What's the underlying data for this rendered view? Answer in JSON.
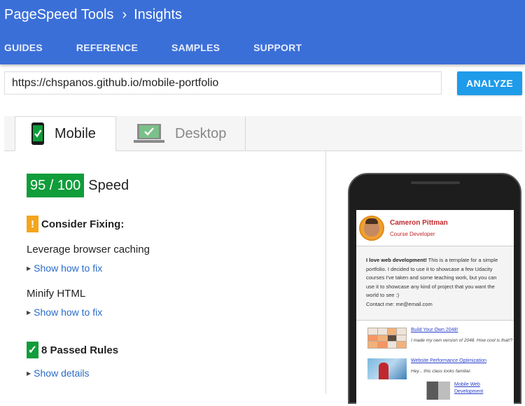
{
  "header": {
    "product": "PageSpeed Tools",
    "chevron": "›",
    "section": "Insights",
    "nav": [
      "GUIDES",
      "REFERENCE",
      "SAMPLES",
      "SUPPORT"
    ]
  },
  "url_bar": {
    "value": "https://chspanos.github.io/mobile-portfolio",
    "button_label": "ANALYZE"
  },
  "tabs": {
    "mobile": "Mobile",
    "desktop": "Desktop",
    "active": "mobile"
  },
  "result": {
    "score": "95 / 100",
    "score_label": "Speed",
    "consider_fixing": {
      "icon": "!",
      "heading": "Consider Fixing:",
      "rules": [
        {
          "name": "Leverage browser caching",
          "link": "Show how to fix"
        },
        {
          "name": "Minify HTML",
          "link": "Show how to fix"
        }
      ]
    },
    "passed": {
      "icon": "✓",
      "heading": "8 Passed Rules",
      "link": "Show details"
    },
    "colors": {
      "score_green": "#109d3a",
      "warn_orange": "#f4a51c",
      "header_blue": "#3b6fd8",
      "button_blue": "#1e9be9",
      "link_blue": "#2a6bc9"
    }
  },
  "preview": {
    "name": "Cameron Pittman",
    "role": "Course Developer",
    "about_bold": "I love web development!",
    "about_text": " This is a template for a simple portfolio. I decided to use it to showcase a few Udacity courses I've taken and some teaching work, but you can use it to showcase any kind of project that you want the world to see :)",
    "contact": "Contact me: me@email.com",
    "projects": [
      {
        "title": "Build Your Own 2048!",
        "desc": "I made my own version of 2048. How cool is that!?"
      },
      {
        "title": "Website Performance Optimization",
        "desc": "Hey... this class looks familiar."
      },
      {
        "title": "Mobile Web Development",
        "desc": ""
      }
    ]
  }
}
